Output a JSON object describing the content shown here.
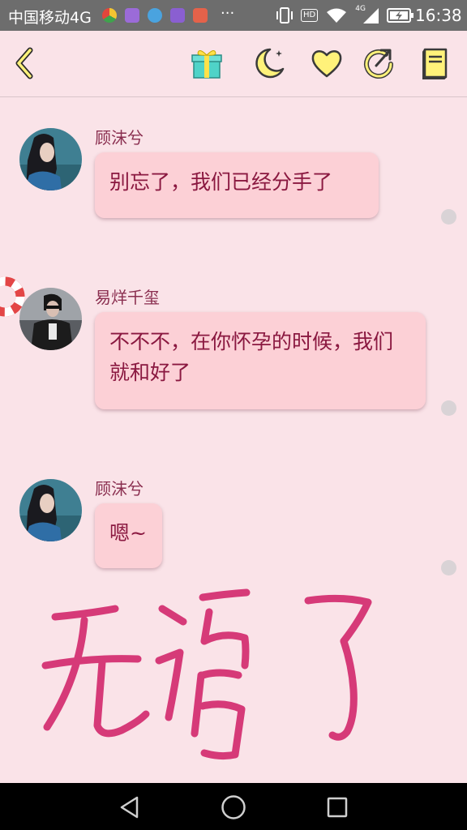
{
  "status_bar": {
    "carrier": "中国移动4G",
    "ellipsis": "···",
    "hd": "HD",
    "network_type": "4G",
    "time": "16:38",
    "icons": [
      "browser-icon",
      "app-icon",
      "app-icon",
      "keyboard-icon",
      "app-icon",
      "vibrate-icon",
      "hd-icon",
      "wifi-icon",
      "signal-icon",
      "battery-charging-icon"
    ]
  },
  "toolbar": {
    "icons": [
      "back-chevron-icon",
      "gift-icon",
      "moon-icon",
      "heart-icon",
      "share-icon",
      "notebook-icon"
    ]
  },
  "messages": [
    {
      "sender": "顾沫兮",
      "text": "别忘了，我们已经分手了"
    },
    {
      "sender": "易烊千玺",
      "text": "不不不，在你怀孕的时候，我们就和好了"
    },
    {
      "sender": "顾沫兮",
      "text": "嗯~"
    }
  ],
  "handwriting": "无语了",
  "nav_bar": {
    "icons": [
      "back-triangle-icon",
      "home-circle-icon",
      "recents-square-icon"
    ]
  },
  "colors": {
    "background": "#fae3e8",
    "bubble": "#fcd0d6",
    "bubble_text": "#8a1840",
    "sender_text": "#8a2e4f",
    "icon_yellow": "#fff27a",
    "scribble": "#d63a78"
  }
}
